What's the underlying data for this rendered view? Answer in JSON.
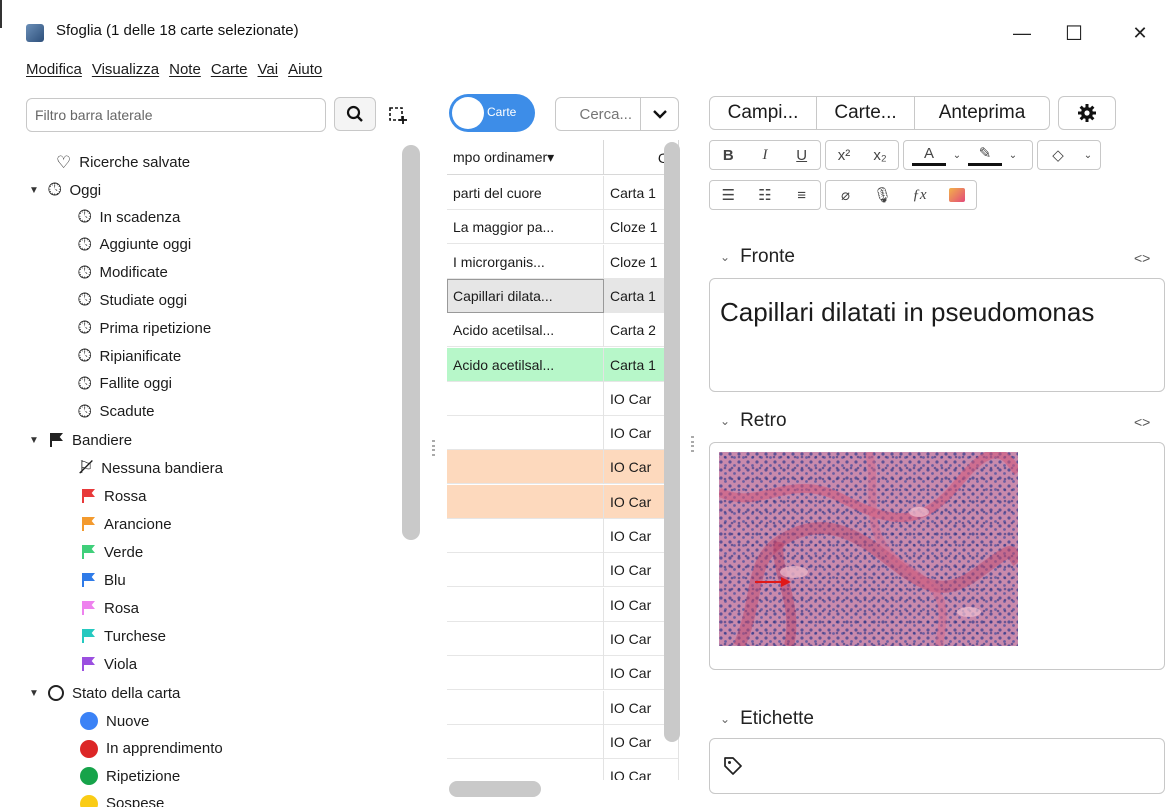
{
  "window": {
    "title": "Sfoglia (1 delle 18 carte selezionate)",
    "controls": [
      "—",
      "☐",
      "✕"
    ]
  },
  "menubar": [
    "Modifica",
    "Visualizza",
    "Note",
    "Carte",
    "Vai",
    "Aiuto"
  ],
  "sidebar": {
    "filter_placeholder": "Filtro barra laterale",
    "saved_searches": "Ricerche salvate",
    "today": {
      "label": "Oggi",
      "items": [
        "In scadenza",
        "Aggiunte oggi",
        "Modificate",
        "Studiate oggi",
        "Prima ripetizione",
        "Ripianificate",
        "Fallite oggi",
        "Scadute"
      ]
    },
    "flags": {
      "label": "Bandiere",
      "none": "Nessuna bandiera",
      "items": [
        {
          "label": "Rossa",
          "color": "#e8393a"
        },
        {
          "label": "Arancione",
          "color": "#f39a2e"
        },
        {
          "label": "Verde",
          "color": "#3fcf7a"
        },
        {
          "label": "Blu",
          "color": "#2f7be8"
        },
        {
          "label": "Rosa",
          "color": "#ee82ee"
        },
        {
          "label": "Turchese",
          "color": "#25c9c0"
        },
        {
          "label": "Viola",
          "color": "#9b4fe0"
        }
      ]
    },
    "card_state": {
      "label": "Stato della carta",
      "items": [
        {
          "label": "Nuove",
          "color": "#3b82f6"
        },
        {
          "label": "In apprendimento",
          "color": "#dc2626"
        },
        {
          "label": "Ripetizione",
          "color": "#16a34a"
        },
        {
          "label": "Sospese",
          "color": "#facc15"
        }
      ]
    }
  },
  "browser": {
    "toggle_label": "Carte",
    "search_placeholder": "Cerca...",
    "columns": [
      "mpo ordinamer▾",
      "C"
    ],
    "rows": [
      {
        "sort": "parti del cuore",
        "card": "Carta 1",
        "bg": "#ffffff"
      },
      {
        "sort": "La maggior pa...",
        "card": "Cloze 1",
        "bg": "#ffffff"
      },
      {
        "sort": "I microrganis...",
        "card": "Cloze 1",
        "bg": "#ffffff"
      },
      {
        "sort": "Capillari dilata...",
        "card": "Carta 1",
        "bg": "#e6e6e6"
      },
      {
        "sort": "Acido acetilsal...",
        "card": "Carta 2",
        "bg": "#ffffff"
      },
      {
        "sort": "Acido acetilsal...",
        "card": "Carta 1",
        "bg": "#b7f7c9"
      },
      {
        "sort": "",
        "card": "IO Car",
        "bg": "#ffffff"
      },
      {
        "sort": "",
        "card": "IO Car",
        "bg": "#ffffff"
      },
      {
        "sort": "",
        "card": "IO Car",
        "bg": "#fdd9bd"
      },
      {
        "sort": "",
        "card": "IO Car",
        "bg": "#fdd9bd"
      },
      {
        "sort": "",
        "card": "IO Car",
        "bg": "#ffffff"
      },
      {
        "sort": "",
        "card": "IO Car",
        "bg": "#ffffff"
      },
      {
        "sort": "",
        "card": "IO Car",
        "bg": "#ffffff"
      },
      {
        "sort": "",
        "card": "IO Car",
        "bg": "#ffffff"
      },
      {
        "sort": "",
        "card": "IO Car",
        "bg": "#ffffff"
      },
      {
        "sort": "",
        "card": "IO Car",
        "bg": "#ffffff"
      },
      {
        "sort": "",
        "card": "IO Car",
        "bg": "#ffffff"
      },
      {
        "sort": "",
        "card": "IO Car",
        "bg": "#ffffff"
      }
    ]
  },
  "editor": {
    "tabs": [
      "Campi...",
      "Carte...",
      "Anteprima"
    ],
    "settings_icon": "gear-icon",
    "front_label": "Fronte",
    "front_text": "Capillari dilatati in pseudomonas",
    "back_label": "Retro",
    "back_image": "histology-image",
    "tags_label": "Etichette",
    "code_toggle": "<>"
  }
}
